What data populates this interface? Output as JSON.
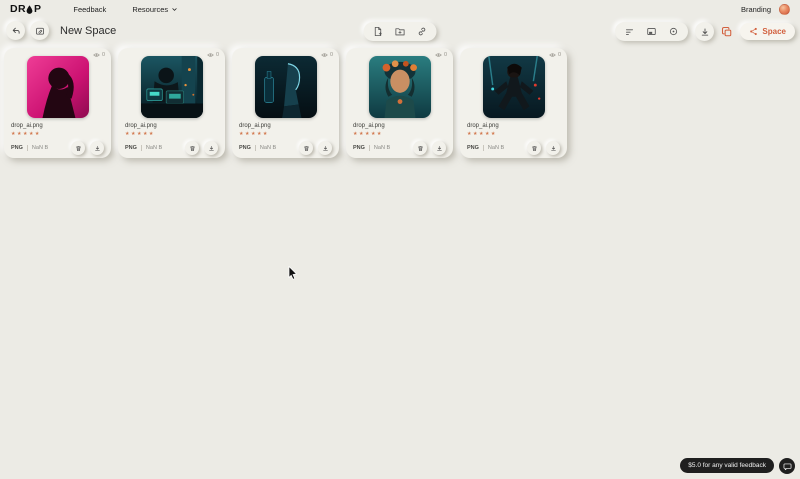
{
  "topbar": {
    "logo_prefix": "DR",
    "logo_suffix": "P",
    "logo_full": "DROP",
    "feedback_label": "Feedback",
    "resources_label": "Resources",
    "branding_label": "Branding"
  },
  "toolbar": {
    "title": "New Space",
    "space_button_label": "Space"
  },
  "cards": [
    {
      "filename": "drop_ai.png",
      "views": "0",
      "stars": "★★★★★",
      "type": "PNG",
      "size": "NaN B"
    },
    {
      "filename": "drop_ai.png",
      "views": "0",
      "stars": "★★★★★",
      "type": "PNG",
      "size": "NaN B"
    },
    {
      "filename": "drop_ai.png",
      "views": "0",
      "stars": "★★★★★",
      "type": "PNG",
      "size": "NaN B"
    },
    {
      "filename": "drop_ai.png",
      "views": "0",
      "stars": "★★★★★",
      "type": "PNG",
      "size": "NaN B"
    },
    {
      "filename": "drop_ai.png",
      "views": "0",
      "stars": "★★★★★",
      "type": "PNG",
      "size": "NaN B"
    }
  ],
  "footer": {
    "feedback_badge": "$5.0 for any valid feedback"
  },
  "colors": {
    "accent": "#D2603E",
    "background": "#ECEBE5",
    "card": "#F2F1EB",
    "badge_bg": "#1F1F1F",
    "star": "#D2794F"
  },
  "icons": {
    "drop-logo-icon": "teardrop",
    "chevron-down-icon": "▾",
    "back-icon": "↩",
    "edit-icon": "✎",
    "file-plus-icon": "file+",
    "folder-plus-icon": "folder+",
    "link-icon": "🔗",
    "sort-icon": "≡",
    "image-icon": "🖼",
    "disc-icon": "⊙",
    "download-icon": "⭳",
    "copy-icon": "⧉",
    "share-icon": "share-nodes",
    "eye-icon": "👁",
    "trash-icon": "🗑",
    "chat-icon": "💬"
  }
}
